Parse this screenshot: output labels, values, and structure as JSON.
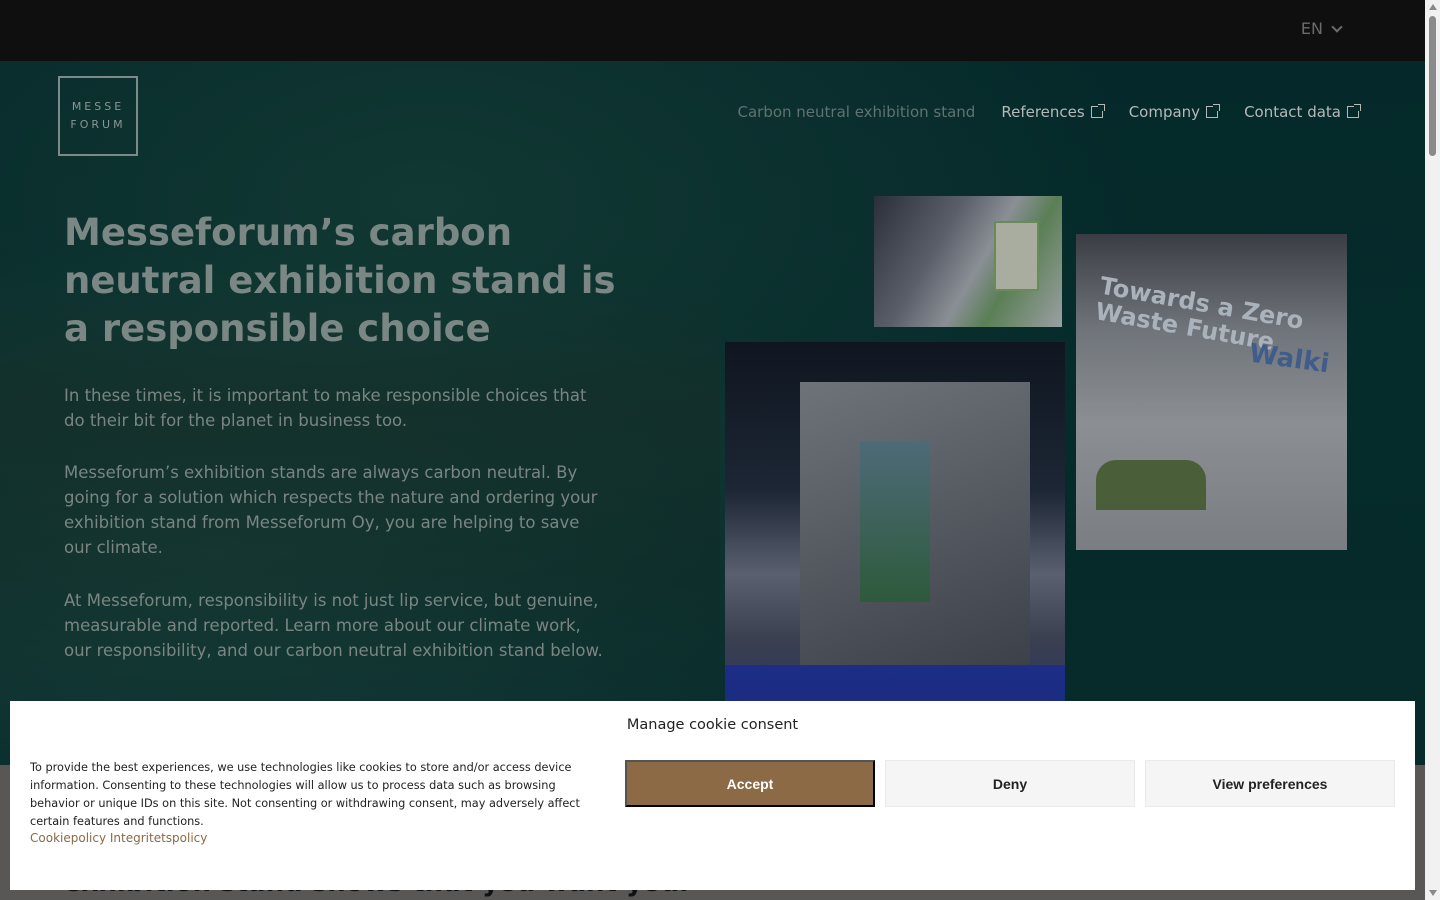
{
  "header": {
    "language": "EN"
  },
  "logo": {
    "line1": "MESSE",
    "line2": "FORUM"
  },
  "nav": {
    "items": [
      {
        "label": "Carbon neutral exhibition stand",
        "active": true
      },
      {
        "label": "References",
        "external": true
      },
      {
        "label": "Company",
        "external": true
      },
      {
        "label": "Contact data",
        "external": true
      }
    ]
  },
  "hero": {
    "title": "Messeforum’s carbon neutral exhibition stand is a responsible choice",
    "paragraphs": [
      "In these times, it is important to make responsible choices that do their bit for the planet in business too.",
      "Messeforum’s exhibition stands are always carbon neutral. By going for a solution which respects the nature and ordering your exhibition stand from Messeforum Oy, you are helping to save our climate.",
      "At Messeforum, responsibility is not just lip service, but genuine, measurable and reported. Learn more about our climate work, our responsibility, and our carbon neutral exhibition stand below."
    ],
    "photo2_text": "Towards a Zero Waste Future",
    "photo2_brand": "Walki"
  },
  "below": {
    "heading_partial": "exhibition stand shows that you want your"
  },
  "cookie": {
    "title": "Manage cookie consent",
    "text": "To provide the best experiences, we use technologies like cookies to store and/or access device information. Consenting to these technologies will allow us to process data such as browsing behavior or unique IDs on this site. Not consenting or withdrawing consent, may adversely affect certain features and functions.",
    "link1": "Cookiepolicy",
    "link2": "Integritetspolicy",
    "accept": "Accept",
    "deny": "Deny",
    "preferences": "View preferences"
  },
  "colors": {
    "accent": "#8b6a45",
    "hero_bg": "#062b2b",
    "topbar": "#0f0f0f"
  }
}
